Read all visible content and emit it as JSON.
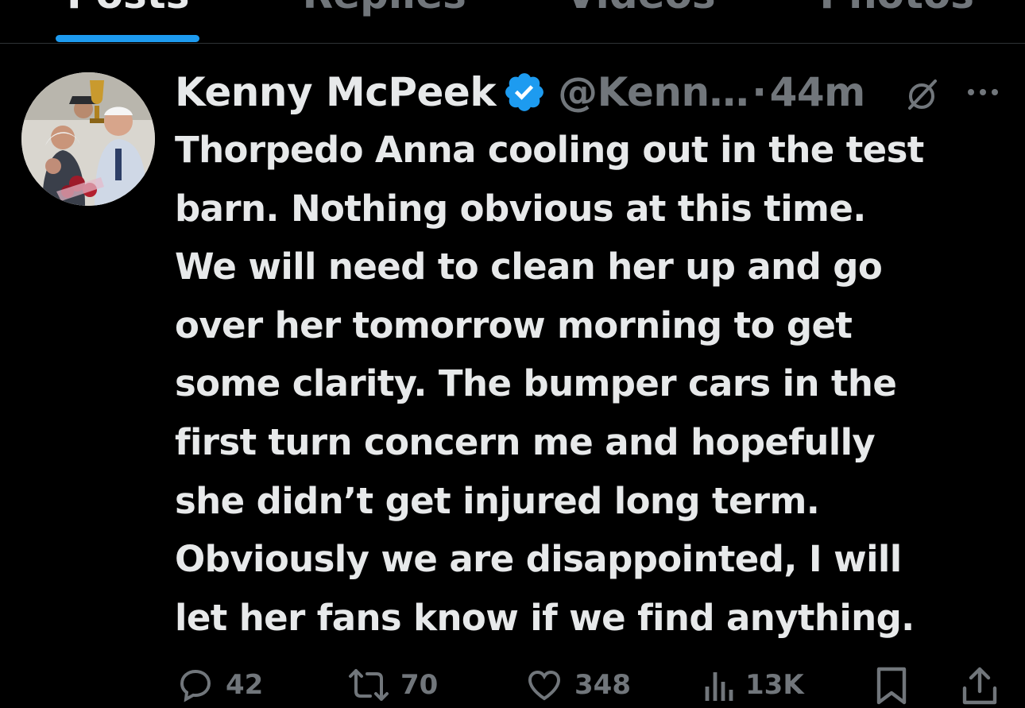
{
  "tabs": [
    {
      "label": "Posts",
      "active": true
    },
    {
      "label": "Replies",
      "active": false
    },
    {
      "label": "Videos",
      "active": false
    },
    {
      "label": "Photos",
      "active": false
    }
  ],
  "post": {
    "display_name": "Kenny McPeek",
    "handle": "@Kenn…",
    "separator": "·",
    "time": "44m",
    "body": "Thorpedo Anna cooling out in the test\nbarn.  Nothing obvious at this time.\nWe will need to clean her up and go\nover her tomorrow morning to get\nsome clarity.   The bumper cars in the\nfirst turn concern me and hopefully\nshe didn’t get injured long term.\nObviously we are disappointed, I will\nlet her fans know if we find anything.",
    "verified": true
  },
  "actions": {
    "replies": "42",
    "reposts": "70",
    "likes": "348",
    "views": "13K"
  },
  "icons": {
    "avatar": "avatar-photo",
    "verified": "verified-badge-icon",
    "grok": "grok-icon",
    "more": "more-icon",
    "reply": "reply-icon",
    "repost": "repost-icon",
    "like": "heart-icon",
    "views": "views-icon",
    "bookmark": "bookmark-icon",
    "share": "share-icon"
  },
  "colors": {
    "background": "#000000",
    "text": "#e7e9ea",
    "secondary": "#71767b",
    "accent": "#1d9bf0",
    "divider": "#2f3336"
  }
}
